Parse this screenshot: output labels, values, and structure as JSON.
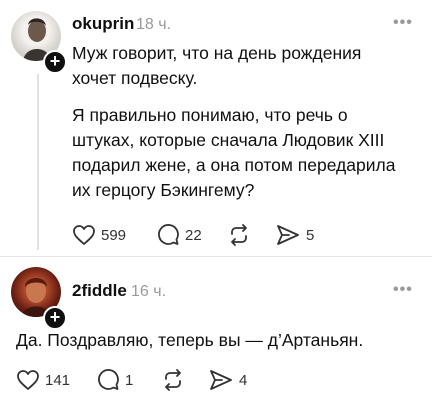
{
  "posts": [
    {
      "username": "okuprin",
      "time": "18 ч.",
      "more": "•••",
      "paragraphs": [
        "Муж говорит, что на день рождения хочет подвеску.",
        "Я правильно понимаю, что речь о штуках, которые сначала Людовик XIII подарил жене, а она потом передарила их герцогу Бэкингему?"
      ],
      "likes": "599",
      "comments": "22",
      "reposts": "",
      "shares": "5"
    },
    {
      "username": "2fiddle",
      "time": "16 ч.",
      "more": "•••",
      "paragraphs": [
        "Да. Поздравляю, теперь вы — д’Артаньян."
      ],
      "likes": "141",
      "comments": "1",
      "reposts": "",
      "shares": "4"
    }
  ],
  "icons": {
    "like": "heart-icon",
    "comment": "comment-icon",
    "repost": "repost-icon",
    "share": "share-icon",
    "follow": "plus-icon"
  }
}
